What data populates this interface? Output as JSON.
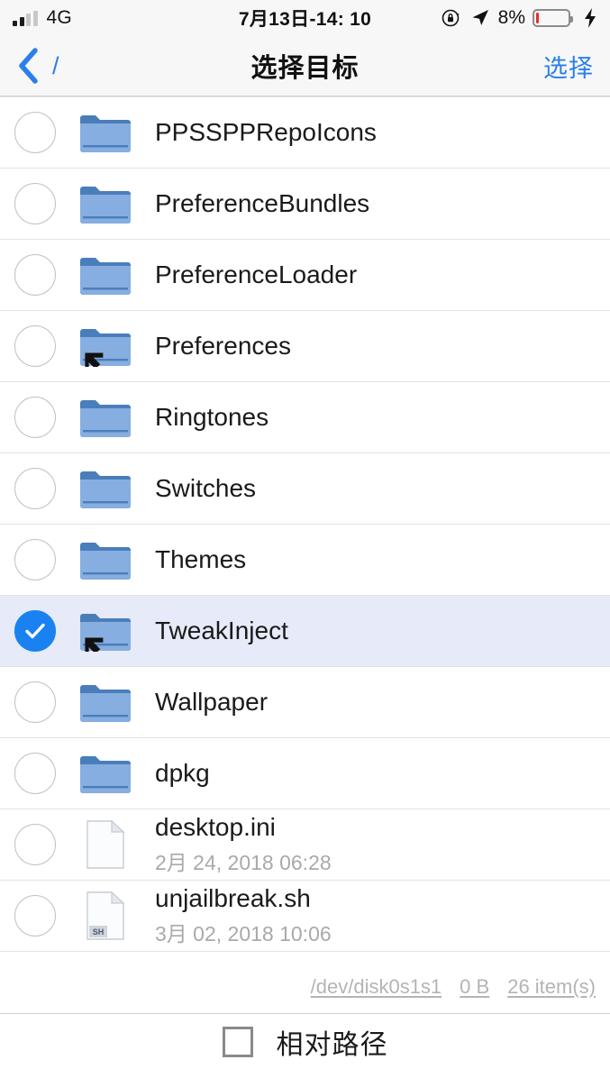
{
  "status_bar": {
    "carrier": "4G",
    "signal_bars_filled": 2,
    "signal_bars_total": 4,
    "time": "7月13日-14: 10",
    "battery_percent": "8%",
    "battery_level": 8,
    "battery_color": "#ec2b2b",
    "charging": true,
    "icons": [
      "signal-bars-icon",
      "rotation-lock-icon",
      "location-arrow-icon",
      "battery-icon",
      "charging-bolt-icon"
    ]
  },
  "nav_bar": {
    "back_icon": "chevron-left-icon",
    "back_label": "/",
    "title": "选择目标",
    "action_label": "选择",
    "accent_color": "#2a7fea"
  },
  "list": {
    "selected_row_bg": "#e7eaf8",
    "rows": [
      {
        "name": "PPSSPPRepoIcons",
        "subtitle": "",
        "icon": "folder-icon",
        "kind": "folder",
        "selected": false
      },
      {
        "name": "PreferenceBundles",
        "subtitle": "",
        "icon": "folder-icon",
        "kind": "folder",
        "selected": false
      },
      {
        "name": "PreferenceLoader",
        "subtitle": "",
        "icon": "folder-icon",
        "kind": "folder",
        "selected": false
      },
      {
        "name": "Preferences",
        "subtitle": "",
        "icon": "folder-alias-icon",
        "kind": "symlink",
        "selected": false
      },
      {
        "name": "Ringtones",
        "subtitle": "",
        "icon": "folder-icon",
        "kind": "folder",
        "selected": false
      },
      {
        "name": "Switches",
        "subtitle": "",
        "icon": "folder-icon",
        "kind": "folder",
        "selected": false
      },
      {
        "name": "Themes",
        "subtitle": "",
        "icon": "folder-icon",
        "kind": "folder",
        "selected": false
      },
      {
        "name": "TweakInject",
        "subtitle": "",
        "icon": "folder-alias-icon",
        "kind": "symlink",
        "selected": true
      },
      {
        "name": "Wallpaper",
        "subtitle": "",
        "icon": "folder-icon",
        "kind": "folder",
        "selected": false
      },
      {
        "name": "dpkg",
        "subtitle": "",
        "icon": "folder-icon",
        "kind": "folder",
        "selected": false
      },
      {
        "name": "desktop.ini",
        "subtitle": "2月 24, 2018 06:28",
        "icon": "document-icon",
        "kind": "file",
        "selected": false
      },
      {
        "name": "unjailbreak.sh",
        "subtitle": "3月 02, 2018 10:06",
        "icon": "document-sh-icon",
        "kind": "file",
        "badge": "SH",
        "selected": false
      }
    ]
  },
  "footer": {
    "device": "/dev/disk0s1s1",
    "size": "0 B",
    "count": "26 item(s)"
  },
  "bottom_bar": {
    "relative_path_checked": false,
    "relative_path_label": "相对路径"
  }
}
